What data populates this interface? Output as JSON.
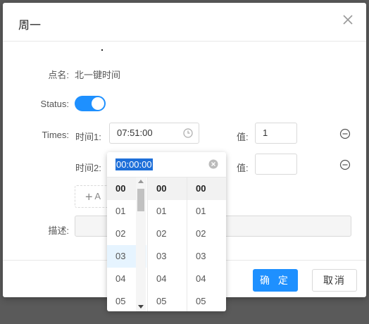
{
  "modal": {
    "title": "周一",
    "footer": {
      "ok_label": "确 定",
      "cancel_label": "取消"
    }
  },
  "form": {
    "name_label": "点名:",
    "name_value": "北一键时间",
    "status_label": "Status:",
    "status_on": true,
    "times_label": "Times:",
    "time1_label": "时间1:",
    "time1_value": "07:51:00",
    "value_label": "值:",
    "value1": "1",
    "time2_label": "时间2:",
    "value2": "",
    "add_label": "A",
    "desc_label": "描述:"
  },
  "picker": {
    "value": "00:00:00",
    "hours": [
      "00",
      "01",
      "02",
      "03",
      "04",
      "05"
    ],
    "minutes": [
      "00",
      "01",
      "02",
      "03",
      "04",
      "05"
    ],
    "seconds": [
      "00",
      "01",
      "02",
      "03",
      "04",
      "05"
    ]
  },
  "colors": {
    "accent": "#1e90ff",
    "selection": "#1e6fd9"
  }
}
